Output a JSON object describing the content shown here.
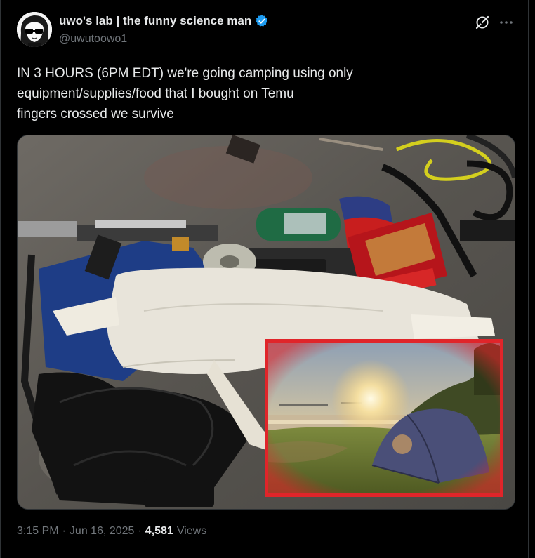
{
  "author": {
    "display_name": "uwo's lab | the funny science man",
    "handle": "@uwutoowo1",
    "verified_icon": "verified-badge-icon",
    "avatar_icon": "anime-avatar-with-sunglasses",
    "verified_color": "#1d9bf0"
  },
  "actions": {
    "grok_icon": "grok-icon",
    "more_icon": "more-dots-icon"
  },
  "tweet": {
    "lines": [
      "IN 3 HOURS (6PM EDT) we're going camping using only",
      "equipment/supplies/food that I bought on Temu",
      "fingers crossed we survive"
    ]
  },
  "media": {
    "main_photo": "camping gear in folding wagon on concrete",
    "inset_photo": "tent on grassy beach at sunset",
    "inset_border_color": "#e0252a"
  },
  "meta": {
    "time": "3:15 PM",
    "separator": "·",
    "date": "Jun 16, 2025",
    "views_count": "4,581",
    "views_label": "Views"
  }
}
